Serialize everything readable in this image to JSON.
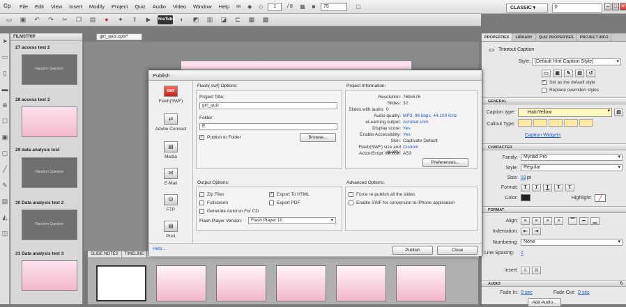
{
  "app": {
    "logo": "Cp",
    "menu": [
      "File",
      "Edit",
      "View",
      "Insert",
      "Modify",
      "Project",
      "Quiz",
      "Audio",
      "Video",
      "Window",
      "Help"
    ],
    "slide_current": "1",
    "slide_total": "/ 8",
    "zoom": "75",
    "workspace": "CLASSIC",
    "window_controls": [
      "–",
      "□",
      "×"
    ]
  },
  "toolbar_icons": [
    "new-icon",
    "save-icon",
    "undo-icon",
    "redo-icon",
    "cut-icon",
    "copy-icon",
    "paste-icon",
    "record-icon",
    "flash-icon",
    "publish-icon",
    "preview-icon",
    "youtube-icon",
    "theme-icon",
    "object-icon",
    "text-icon",
    "shape-icon",
    "interaction-icon",
    "table-icon",
    "grid-icon"
  ],
  "youtube_label": "YouTube",
  "doc_tab": "girl_quiz.cptx*",
  "filmstrip": {
    "title": "FILMSTRIP",
    "slides": [
      {
        "label": "27 access test 2",
        "style": "gray",
        "text": "Random Question"
      },
      {
        "label": "28 access test 3",
        "style": "pink",
        "text": ""
      },
      {
        "label": "29 data analysis test",
        "style": "gray",
        "text": "Random Question"
      },
      {
        "label": "30 Data analysis test 2",
        "style": "gray",
        "text": "Random Question"
      },
      {
        "label": "31 Data analysis test 3",
        "style": "pink",
        "text": ""
      }
    ]
  },
  "bottom_tabs": [
    "SLIDE NOTES",
    "TIMELINE"
  ],
  "dialog": {
    "title": "Publish",
    "side_items": [
      {
        "label": "Flash(SWF)",
        "icon": "SWF"
      },
      {
        "label": "Adobe Connect",
        "icon": "⇄"
      },
      {
        "label": "Media",
        "icon": "▤"
      },
      {
        "label": "E-Mail",
        "icon": "✉"
      },
      {
        "label": "FTP",
        "icon": "⛁"
      },
      {
        "label": "Print",
        "icon": "▤"
      }
    ],
    "options_title": "Flash(.swf) Options:",
    "project_title_label": "Project Title:",
    "project_title_value": "girl_quiz",
    "folder_label": "Folder:",
    "folder_value": "E:",
    "publish_to_folder": "Publish to Folder",
    "browse": "Browse...",
    "info_title": "Project Information:",
    "info": [
      {
        "k": "Resolution:",
        "v": "768x576",
        "blue": false
      },
      {
        "k": "Slides:",
        "v": "32",
        "blue": false
      },
      {
        "k": "Slides with audio:",
        "v": "0",
        "blue": false
      },
      {
        "k": "Audio quality:",
        "v": "MP3, 96 kbps, 44.100 KHz",
        "blue": true
      },
      {
        "k": "eLearning output:",
        "v": "Acrobat.com",
        "blue": true
      },
      {
        "k": "Display score:",
        "v": "Yes",
        "blue": true
      },
      {
        "k": "Enable Accessibility:",
        "v": "Yes",
        "blue": true
      },
      {
        "k": "Skin:",
        "v": "Captivate Default",
        "blue": false
      },
      {
        "k": "Flash(SWF) size and quality:",
        "v": "Custom",
        "blue": true
      },
      {
        "k": "ActionScript Version:",
        "v": "AS3",
        "blue": false
      }
    ],
    "preferences": "Preferences...",
    "output_title": "Output Options:",
    "zip": "Zip Files",
    "export_html": "Export To HTML",
    "fullscreen": "Fullscreen",
    "export_pdf": "Export PDF",
    "autorun": "Generate Autorun For CD",
    "flash_player_label": "Flash Player Version:",
    "flash_player_value": "Flash Player 10",
    "advanced_title": "Advanced Options:",
    "force": "Force re-publish all the slides",
    "iphone": "Enable SWF for conversion to iPhone application",
    "help": "Help...",
    "publish": "Publish",
    "close": "Close"
  },
  "right_panel": {
    "tabs": [
      "PROPERTIES",
      "LIBRARY",
      "QUIZ PROPERTIES",
      "PROJECT INFO"
    ],
    "object_name": "Timeout Caption",
    "style_label": "Style:",
    "style_value": "[Default Hint Caption Style]",
    "set_default": "Set as the default style",
    "replace_styles": "Replace overriden styles",
    "general": "GENERAL",
    "caption_type_label": "Caption type:",
    "caption_type_value": "HaloYellow",
    "callout_label": "Callout Type:",
    "caption_widgets": "Caption Widgets",
    "character": "CHARACTER",
    "family_label": "Family:",
    "family_value": "Myriad Pro",
    "style2_label": "Style:",
    "style2_value": "Regular",
    "size_label": "Size:",
    "size_value": "19",
    "size_unit": "pt",
    "format_label": "Format:",
    "format_buttons": [
      "T",
      "T",
      "T",
      "T",
      "T"
    ],
    "color_label": "Color:",
    "highlight_label": "Highlight:",
    "format_section": "FORMAT",
    "align_label": "Align:",
    "indentation_label": "Indentation:",
    "numbering_label": "Numbering:",
    "numbering_value": "None",
    "line_spacing_label": "Line Spacing:",
    "line_spacing_value": "1",
    "insert_label": "Insert:",
    "audio": "AUDIO",
    "fade_in_label": "Fade In:",
    "fade_in_value": "0 sec",
    "fade_out_label": "Fade Out:",
    "fade_out_value": "0 sec",
    "add_audio": "Add Audio..."
  }
}
